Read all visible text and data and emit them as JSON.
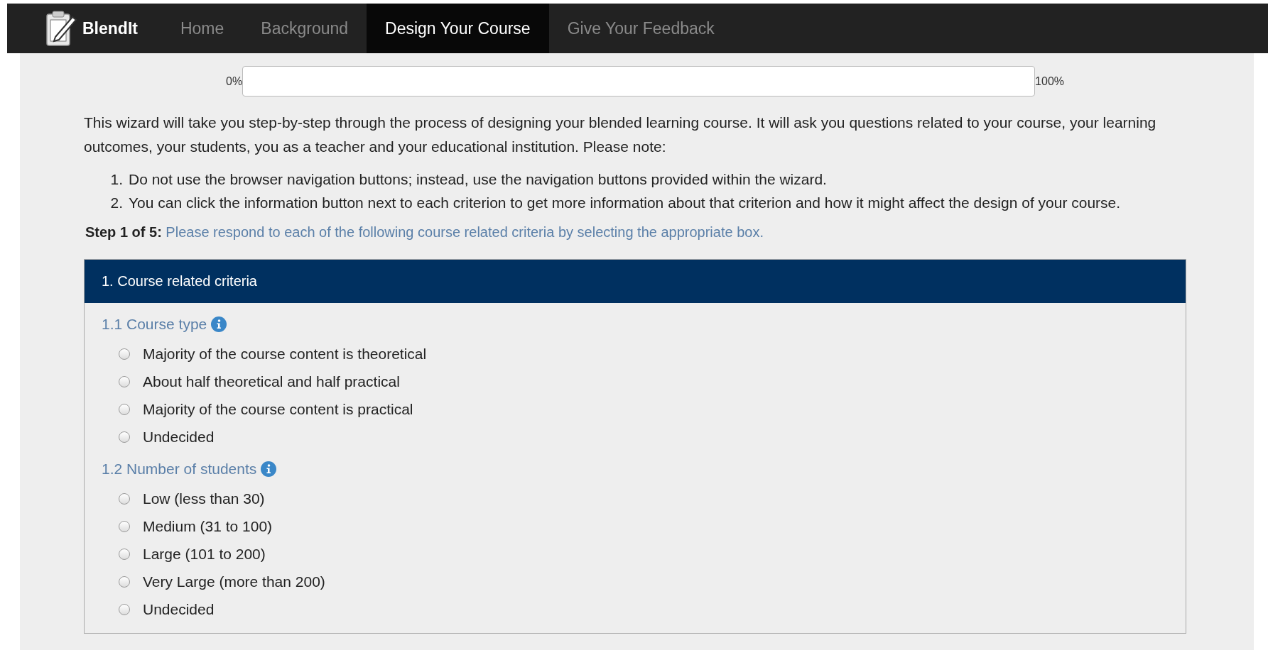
{
  "navbar": {
    "brand": "BlendIt",
    "tabs": [
      {
        "label": "Home",
        "selected": false
      },
      {
        "label": "Background",
        "selected": false
      },
      {
        "label": "Design Your Course",
        "selected": true
      },
      {
        "label": "Give Your Feedback",
        "selected": false
      }
    ]
  },
  "progress": {
    "start_label": "0%",
    "end_label": "100%",
    "level": 0
  },
  "intro": "This wizard will take you step-by-step through the process of designing your blended learning course. It will ask you questions related to your course, your learning outcomes, your students, you as a teacher and your educational institution. Please note:",
  "notes": [
    {
      "marker": "1.",
      "text": "Do not use the browser navigation buttons; instead, use the navigation buttons provided within the wizard."
    },
    {
      "marker": "2.",
      "text": "You can click the information button next to each criterion to get more information about that criterion and how it might affect the design of your course."
    }
  ],
  "step": {
    "label": "Step 1 of 5:",
    "instruction": "Please respond to each of the following course related criteria by selecting the appropriate box."
  },
  "panel": {
    "title": "1. Course related criteria",
    "criteria": [
      {
        "title": "1.1 Course type",
        "options": [
          {
            "label": "Majority of the course content is theoretical",
            "selected": false
          },
          {
            "label": "About half theoretical and half practical",
            "selected": false
          },
          {
            "label": "Majority of the course content is practical",
            "selected": false
          },
          {
            "label": "Undecided",
            "selected": false
          }
        ]
      },
      {
        "title": "1.2 Number of students",
        "options": [
          {
            "label": "Low (less than 30)",
            "selected": false
          },
          {
            "label": "Medium (31 to 100)",
            "selected": false
          },
          {
            "label": "Large (101 to 200)",
            "selected": false
          },
          {
            "label": "Very Large (more than 200)",
            "selected": false
          },
          {
            "label": "Undecided",
            "selected": false
          }
        ]
      }
    ]
  }
}
